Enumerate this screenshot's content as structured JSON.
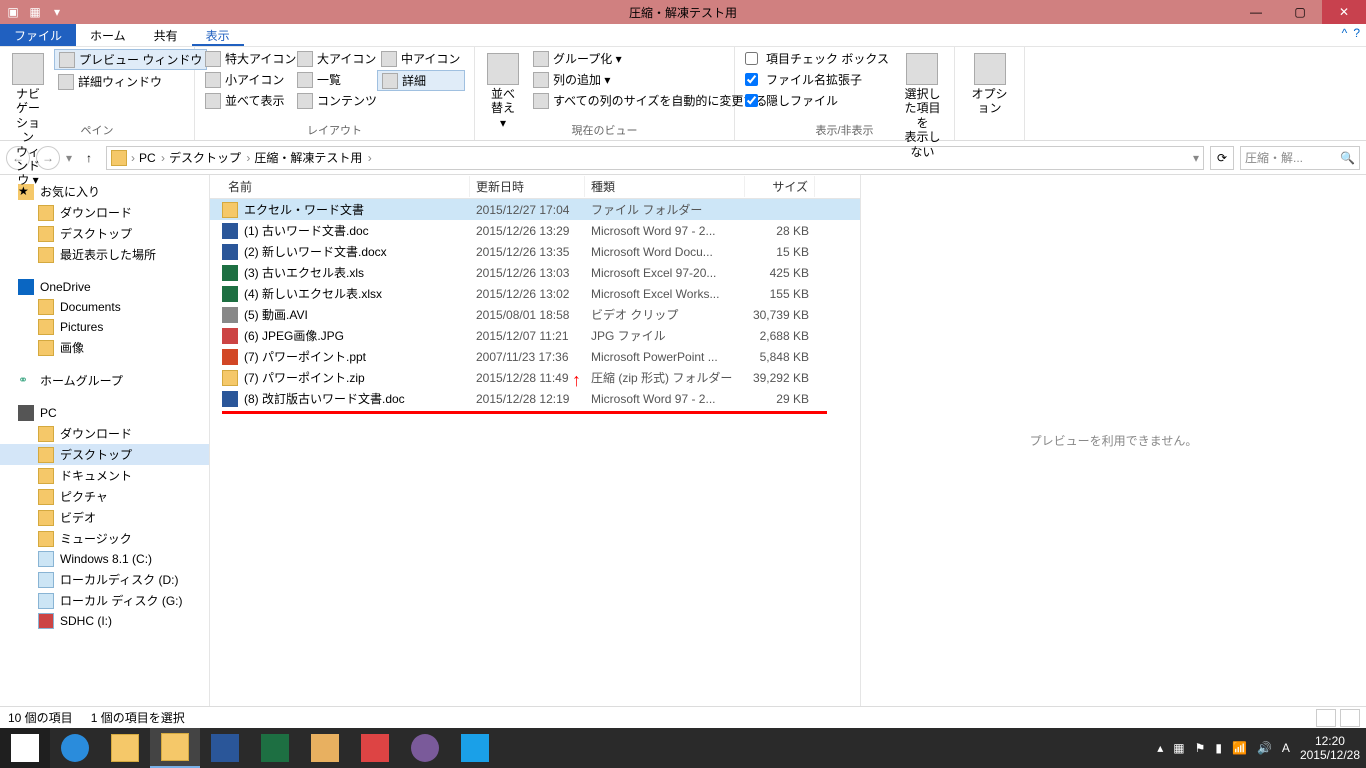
{
  "window": {
    "title": "圧縮・解凍テスト用"
  },
  "tabs": {
    "file": "ファイル",
    "home": "ホーム",
    "share": "共有",
    "view": "表示"
  },
  "ribbon": {
    "pane": {
      "nav": "ナビゲーション\nウィンドウ ▾",
      "preview": "プレビュー ウィンドウ",
      "detailspane": "詳細ウィンドウ",
      "label": "ペイン"
    },
    "layout": {
      "xlarge": "特大アイコン",
      "large": "大アイコン",
      "medium": "中アイコン",
      "small": "小アイコン",
      "list": "一覧",
      "details": "詳細",
      "tiles": "並べて表示",
      "content": "コンテンツ",
      "label": "レイアウト"
    },
    "current": {
      "sort": "並べ替え ▾",
      "group": "グループ化 ▾",
      "addcol": "列の追加 ▾",
      "autosize": "すべての列のサイズを自動的に変更する",
      "label": "現在のビュー"
    },
    "showhide": {
      "checkboxes": "項目チェック ボックス",
      "ext": "ファイル名拡張子",
      "hidden": "隠しファイル",
      "hideselected": "選択した項目を\n表示しない",
      "label": "表示/非表示"
    },
    "options": "オプション"
  },
  "breadcrumb": {
    "items": [
      "PC",
      "デスクトップ",
      "圧縮・解凍テスト用"
    ]
  },
  "search": {
    "placeholder": "圧縮・解..."
  },
  "nav": {
    "favorites": "お気に入り",
    "favitems": [
      "ダウンロード",
      "デスクトップ",
      "最近表示した場所"
    ],
    "onedrive": "OneDrive",
    "oditems": [
      "Documents",
      "Pictures",
      "画像"
    ],
    "homegroup": "ホームグループ",
    "pc": "PC",
    "pcitems": [
      "ダウンロード",
      "デスクトップ",
      "ドキュメント",
      "ピクチャ",
      "ビデオ",
      "ミュージック",
      "Windows 8.1 (C:)",
      "ローカルディスク (D:)",
      "ローカル ディスク (G:)",
      "SDHC (I:)"
    ]
  },
  "columns": {
    "name": "名前",
    "date": "更新日時",
    "type": "種類",
    "size": "サイズ"
  },
  "files": [
    {
      "name": "エクセル・ワード文書",
      "date": "2015/12/27 17:04",
      "type": "ファイル フォルダー",
      "size": "",
      "icon": "folder",
      "selected": true
    },
    {
      "name": "(1) 古いワード文書.doc",
      "date": "2015/12/26 13:29",
      "type": "Microsoft Word 97 - 2...",
      "size": "28 KB",
      "icon": "doc"
    },
    {
      "name": "(2) 新しいワード文書.docx",
      "date": "2015/12/26 13:35",
      "type": "Microsoft Word Docu...",
      "size": "15 KB",
      "icon": "doc"
    },
    {
      "name": "(3) 古いエクセル表.xls",
      "date": "2015/12/26 13:03",
      "type": "Microsoft Excel 97-20...",
      "size": "425 KB",
      "icon": "xls"
    },
    {
      "name": "(4) 新しいエクセル表.xlsx",
      "date": "2015/12/26 13:02",
      "type": "Microsoft Excel Works...",
      "size": "155 KB",
      "icon": "xls"
    },
    {
      "name": "(5) 動画.AVI",
      "date": "2015/08/01 18:58",
      "type": "ビデオ クリップ",
      "size": "30,739 KB",
      "icon": "avi"
    },
    {
      "name": "(6) JPEG画像.JPG",
      "date": "2015/12/07 11:21",
      "type": "JPG ファイル",
      "size": "2,688 KB",
      "icon": "jpg"
    },
    {
      "name": "(7) パワーポイント.ppt",
      "date": "2007/11/23 17:36",
      "type": "Microsoft PowerPoint ...",
      "size": "5,848 KB",
      "icon": "ppt"
    },
    {
      "name": "(7) パワーポイント.zip",
      "date": "2015/12/28 11:49",
      "type": "圧縮 (zip 形式) フォルダー",
      "size": "39,292 KB",
      "icon": "zip"
    },
    {
      "name": "(8) 改訂版古いワード文書.doc",
      "date": "2015/12/28 12:19",
      "type": "Microsoft Word 97 - 2...",
      "size": "29 KB",
      "icon": "doc"
    }
  ],
  "preview": {
    "unavailable": "プレビューを利用できません。"
  },
  "status": {
    "count": "10 個の項目",
    "selected": "1 個の項目を選択"
  },
  "tray": {
    "time": "12:20",
    "date": "2015/12/28",
    "ime": "A"
  }
}
